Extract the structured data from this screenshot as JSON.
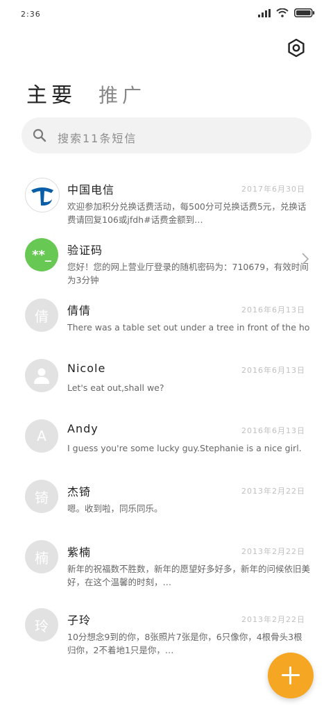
{
  "status_bar": {
    "time": "2:36"
  },
  "tabs": {
    "main": "主要",
    "promo": "推广"
  },
  "search": {
    "placeholder": "搜索11条短信"
  },
  "messages": [
    {
      "name": "中国电信",
      "date": "2017年6月30日",
      "text": "欢迎参加积分兑换话费活动，每500分可兑换话费5元，兑换话费请回复106或jfdh#话费金额到…",
      "avatar": "telecom-logo"
    },
    {
      "name": "验证码",
      "date": "",
      "text": "您好！您的网上营业厅登录的随机密码为：710679，有效时间为3分钟",
      "avatar": "**_"
    },
    {
      "name": "倩倩",
      "date": "2016年6月13日",
      "text": "There was a table set out under a tree in front of the hous",
      "avatar": "倩"
    },
    {
      "name": "Nicole",
      "date": "2016年6月13日",
      "text": "Let's eat out,shall we?",
      "avatar": "person-icon"
    },
    {
      "name": "Andy",
      "date": "2016年6月13日",
      "text": "I guess you're some lucky guy.Stephanie is a nice girl.",
      "avatar": "A"
    },
    {
      "name": "杰锜",
      "date": "2013年2月22日",
      "text": "嗯。收到啦，同乐同乐。",
      "avatar": "锜"
    },
    {
      "name": "紫楠",
      "date": "2013年2月22日",
      "text": "新年的祝福数不胜数，新年的愿望好多好多，新年的问候依旧美好，在这个温馨的时刻，…",
      "avatar": "楠"
    },
    {
      "name": "子玲",
      "date": "2013年2月22日",
      "text": "10分想念9到的你，8张照片7张是你，6只像你，4根骨头3根归你，2不着地1只是你，…",
      "avatar": "玲"
    }
  ],
  "colors": {
    "fab": "#f5a623",
    "verify_avatar": "#67c853",
    "telecom_blue": "#0a5ea8"
  }
}
